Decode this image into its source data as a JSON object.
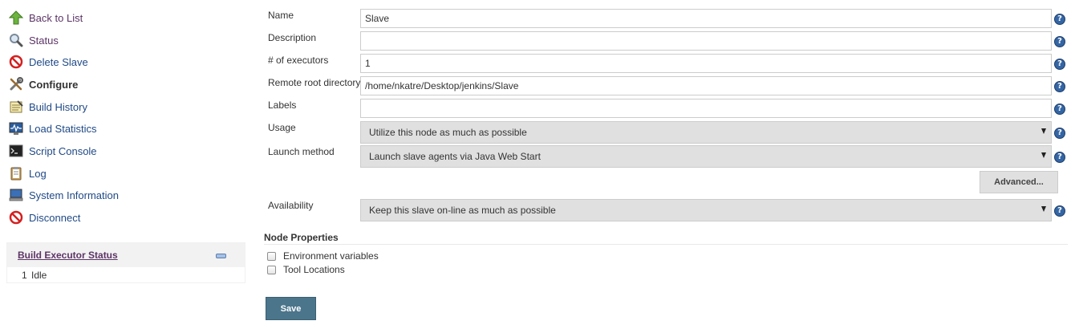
{
  "sidebar": {
    "tasks": [
      {
        "label": "Back to List",
        "icon": "up-arrow-icon"
      },
      {
        "label": "Status",
        "icon": "magnifier-icon"
      },
      {
        "label": "Delete Slave",
        "icon": "no-entry-icon"
      },
      {
        "label": "Configure",
        "icon": "tools-icon"
      },
      {
        "label": "Build History",
        "icon": "notepad-icon"
      },
      {
        "label": "Load Statistics",
        "icon": "monitor-graph-icon"
      },
      {
        "label": "Script Console",
        "icon": "terminal-icon"
      },
      {
        "label": "Log",
        "icon": "clipboard-icon"
      },
      {
        "label": "System Information",
        "icon": "computer-icon"
      },
      {
        "label": "Disconnect",
        "icon": "no-entry-icon"
      }
    ],
    "executor_status": {
      "title": "Build Executor Status",
      "executors": [
        {
          "number": "1",
          "state": "Idle"
        }
      ]
    }
  },
  "form": {
    "name": {
      "label": "Name",
      "value": "Slave"
    },
    "description": {
      "label": "Description",
      "value": ""
    },
    "executors": {
      "label": "# of executors",
      "value": "1"
    },
    "remote_root": {
      "label": "Remote root directory",
      "value": "/home/nkatre/Desktop/jenkins/Slave"
    },
    "labels": {
      "label": "Labels",
      "value": ""
    },
    "usage": {
      "label": "Usage",
      "value": "Utilize this node as much as possible"
    },
    "launch_method": {
      "label": "Launch method",
      "value": "Launch slave agents via Java Web Start"
    },
    "advanced_button": "Advanced...",
    "availability": {
      "label": "Availability",
      "value": "Keep this slave on-line as much as possible"
    },
    "help_glyph": "?",
    "node_properties": {
      "title": "Node Properties",
      "options": [
        {
          "label": "Environment variables",
          "checked": false
        },
        {
          "label": "Tool Locations",
          "checked": false
        }
      ]
    },
    "save_button": "Save"
  },
  "colors": {
    "link": "#204a87",
    "visited_link": "#5c3566",
    "save_button": "#4b758b",
    "help_icon": "#3465a4",
    "select_background": "#e0e0e0"
  }
}
